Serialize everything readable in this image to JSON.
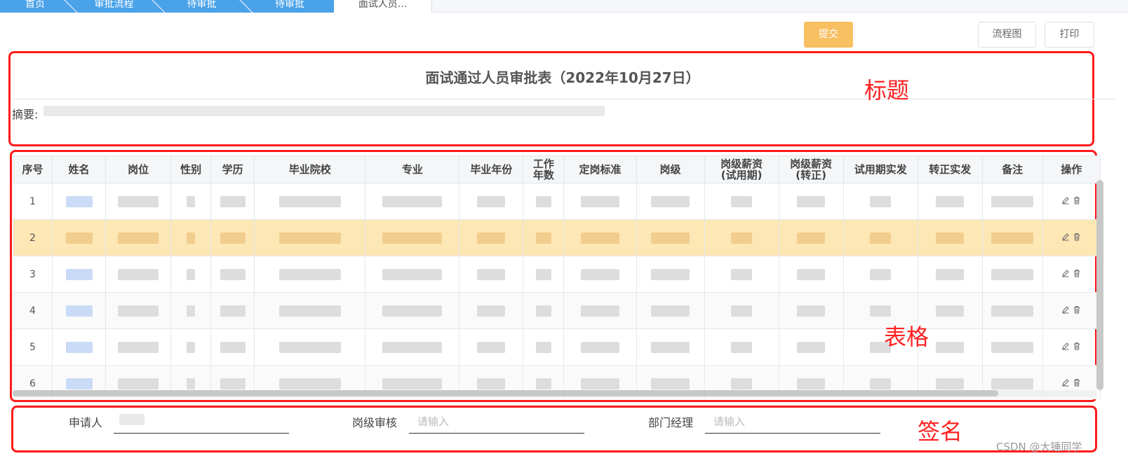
{
  "tabs": [
    {
      "label": "首页"
    },
    {
      "label": "审批流程"
    },
    {
      "label": "待审批"
    },
    {
      "label": "待审批"
    },
    {
      "label": "面试人员..."
    }
  ],
  "toolbar": {
    "submit_label": "提交",
    "flowchart_label": "流程图",
    "print_label": "打印"
  },
  "form": {
    "title": "面试通过人员审批表（2022年10月27日）",
    "summary_label": "摘要:"
  },
  "annotations": {
    "title": "标题",
    "table": "表格",
    "signature": "签名"
  },
  "table": {
    "headers": [
      "序号",
      "姓名",
      "岗位",
      "性别",
      "学历",
      "毕业院校",
      "专业",
      "毕业年份",
      "工作\n年数",
      "定岗标准",
      "岗级",
      "岗级薪资\n(试用期)",
      "岗级薪资\n(转正)",
      "试用期实发",
      "转正实发",
      "备注",
      "操作"
    ],
    "rows": [
      {
        "index": "1"
      },
      {
        "index": "2"
      },
      {
        "index": "3"
      },
      {
        "index": "4"
      },
      {
        "index": "5"
      },
      {
        "index": "6"
      }
    ]
  },
  "signature": {
    "applicant_label": "申请人",
    "grade_review_label": "岗级审核",
    "grade_review_placeholder": "请输入",
    "dept_manager_label": "部门经理",
    "dept_manager_placeholder": "请输入"
  },
  "watermark": "CSDN @大锤同学",
  "colors": {
    "primary_button": "#f8c061",
    "tab_blue": "#4aa2e8",
    "row_highlight": "#fde7b5",
    "annotation_red": "#ff1a1a"
  }
}
